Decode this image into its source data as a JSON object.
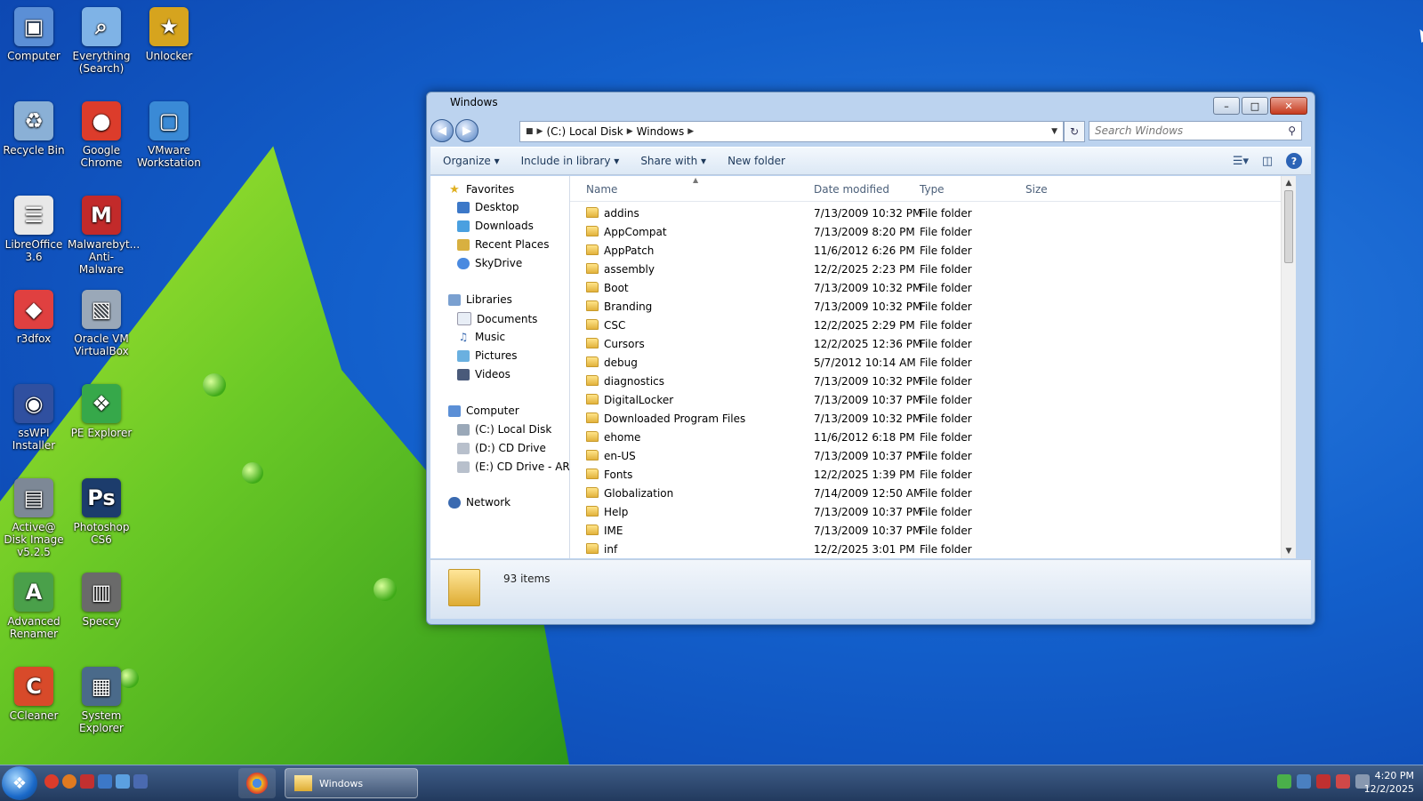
{
  "desktop": {
    "icons": [
      {
        "label": "Computer",
        "glyph": "▣",
        "color": "#5b8fd6"
      },
      {
        "label": "Everything (Search)",
        "glyph": "⌕",
        "color": "#7fb3e6"
      },
      {
        "label": "Unlocker",
        "glyph": "★",
        "color": "#d6a41e"
      },
      {
        "label": "Recycle Bin",
        "glyph": "♻",
        "color": "#8ab0d6"
      },
      {
        "label": "Google Chrome",
        "glyph": "●",
        "color": "#dc3c2b"
      },
      {
        "label": "VMware Workstation",
        "glyph": "▢",
        "color": "#3a8ad6"
      },
      {
        "label": "LibreOffice 3.6",
        "glyph": "☰",
        "color": "#e8e8e8"
      },
      {
        "label": "Malwarebyt... Anti-Malware",
        "glyph": "M",
        "color": "#c22a2a"
      },
      {
        "label": "r3dfox",
        "glyph": "◆",
        "color": "#e04040"
      },
      {
        "label": "Oracle VM VirtualBox",
        "glyph": "▧",
        "color": "#9aa8b8"
      },
      {
        "label": "ssWPI Installer",
        "glyph": "◉",
        "color": "#3050a0"
      },
      {
        "label": "PE Explorer",
        "glyph": "❖",
        "color": "#36a84a"
      },
      {
        "label": "Active@ Disk Image v5.2.5",
        "glyph": "▤",
        "color": "#7d8896"
      },
      {
        "label": "Photoshop CS6",
        "glyph": "Ps",
        "color": "#1c3c6c"
      },
      {
        "label": "Advanced Renamer",
        "glyph": "A",
        "color": "#4aa04a"
      },
      {
        "label": "Speccy",
        "glyph": "▥",
        "color": "#6a6a6a"
      },
      {
        "label": "CCleaner",
        "glyph": "C",
        "color": "#d84a2a"
      },
      {
        "label": "System Explorer",
        "glyph": "▦",
        "color": "#4a6a8a"
      }
    ]
  },
  "window": {
    "title": "Windows",
    "breadcrumb": [
      "(C:) Local Disk",
      "Windows"
    ],
    "search_placeholder": "Search Windows",
    "toolbar": {
      "organize": "Organize ▾",
      "include": "Include in library ▾",
      "share": "Share with ▾",
      "newfolder": "New folder"
    },
    "nav": {
      "favorites": "Favorites",
      "desktop": "Desktop",
      "downloads": "Downloads",
      "recent": "Recent Places",
      "skydrive": "SkyDrive",
      "libraries": "Libraries",
      "documents": "Documents",
      "music": "Music",
      "pictures": "Pictures",
      "videos": "Videos",
      "computer": "Computer",
      "c": "(C:) Local Disk",
      "d": "(D:) CD Drive",
      "e": "(E:) CD Drive - ARCH",
      "network": "Network"
    },
    "columns": {
      "name": "Name",
      "date": "Date modified",
      "type": "Type",
      "size": "Size"
    },
    "rows": [
      {
        "name": "addins",
        "date": "7/13/2009 10:32 PM",
        "type": "File folder"
      },
      {
        "name": "AppCompat",
        "date": "7/13/2009 8:20 PM",
        "type": "File folder"
      },
      {
        "name": "AppPatch",
        "date": "11/6/2012 6:26 PM",
        "type": "File folder"
      },
      {
        "name": "assembly",
        "date": "12/2/2025 2:23 PM",
        "type": "File folder"
      },
      {
        "name": "Boot",
        "date": "7/13/2009 10:32 PM",
        "type": "File folder"
      },
      {
        "name": "Branding",
        "date": "7/13/2009 10:32 PM",
        "type": "File folder"
      },
      {
        "name": "CSC",
        "date": "12/2/2025 2:29 PM",
        "type": "File folder"
      },
      {
        "name": "Cursors",
        "date": "12/2/2025 12:36 PM",
        "type": "File folder"
      },
      {
        "name": "debug",
        "date": "5/7/2012 10:14 AM",
        "type": "File folder"
      },
      {
        "name": "diagnostics",
        "date": "7/13/2009 10:32 PM",
        "type": "File folder"
      },
      {
        "name": "DigitalLocker",
        "date": "7/13/2009 10:37 PM",
        "type": "File folder"
      },
      {
        "name": "Downloaded Program Files",
        "date": "7/13/2009 10:32 PM",
        "type": "File folder"
      },
      {
        "name": "ehome",
        "date": "11/6/2012 6:18 PM",
        "type": "File folder"
      },
      {
        "name": "en-US",
        "date": "7/13/2009 10:37 PM",
        "type": "File folder"
      },
      {
        "name": "Fonts",
        "date": "12/2/2025 1:39 PM",
        "type": "File folder"
      },
      {
        "name": "Globalization",
        "date": "7/14/2009 12:50 AM",
        "type": "File folder"
      },
      {
        "name": "Help",
        "date": "7/13/2009 10:37 PM",
        "type": "File folder"
      },
      {
        "name": "IME",
        "date": "7/13/2009 10:37 PM",
        "type": "File folder"
      },
      {
        "name": "inf",
        "date": "12/2/2025 3:01 PM",
        "type": "File folder"
      }
    ],
    "status": "93 items"
  },
  "taskbar": {
    "task_label": "Windows",
    "time": "4:20 PM",
    "date": "12/2/2025"
  }
}
